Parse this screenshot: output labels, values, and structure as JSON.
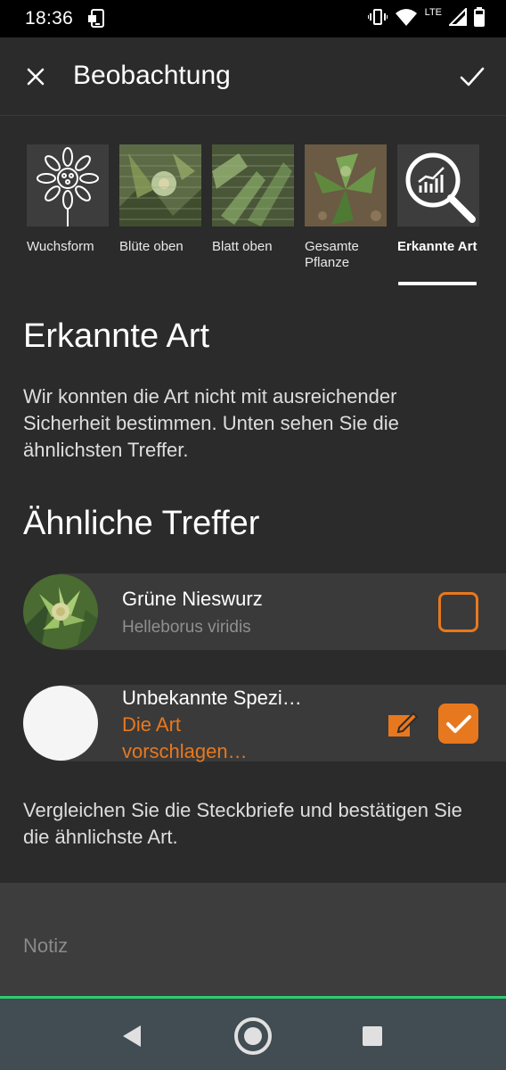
{
  "status_bar": {
    "time": "18:36",
    "network": "LTE",
    "icons": [
      "screenshot-icon",
      "vibrate-icon",
      "wifi-icon",
      "cell-signal-icon",
      "battery-icon"
    ]
  },
  "app_bar": {
    "title": "Beobachtung",
    "close_icon": "close-icon",
    "confirm_icon": "check-icon"
  },
  "tabs": [
    {
      "label": "Wuchsform",
      "icon": "flower-outline-icon",
      "active": false
    },
    {
      "label": "Blüte oben",
      "icon": "photo-flower-top",
      "active": false
    },
    {
      "label": "Blatt oben",
      "icon": "photo-leaf-top",
      "active": false
    },
    {
      "label": "Gesamte Pflanze",
      "icon": "photo-whole-plant",
      "active": false
    },
    {
      "label": "Erkannte Art",
      "icon": "chart-search-icon",
      "active": true
    }
  ],
  "recognized": {
    "title": "Erkannte Art",
    "description": "Wir konnten die Art nicht mit ausreichender Sicherheit bestimmen. Unten sehen Sie die ähnlichsten Treffer."
  },
  "similar": {
    "title": "Ähnliche Treffer",
    "matches": [
      {
        "name": "Grüne Nieswurz",
        "scientific": "Helleborus viridis",
        "checked": false
      },
      {
        "name": "Unbekannte Spezi…",
        "suggest": "Die Art vorschlagen…",
        "checked": true
      }
    ],
    "compare_hint": "Vergleichen Sie die Steckbriefe und bestätigen Sie die ähnlichste Art."
  },
  "note": {
    "label": "Notiz"
  },
  "colors": {
    "accent": "#e8781e",
    "background": "#2b2b2b",
    "card": "#3a3a3a",
    "focus_underline": "#2ecc71",
    "nav_bar": "#414c53"
  }
}
